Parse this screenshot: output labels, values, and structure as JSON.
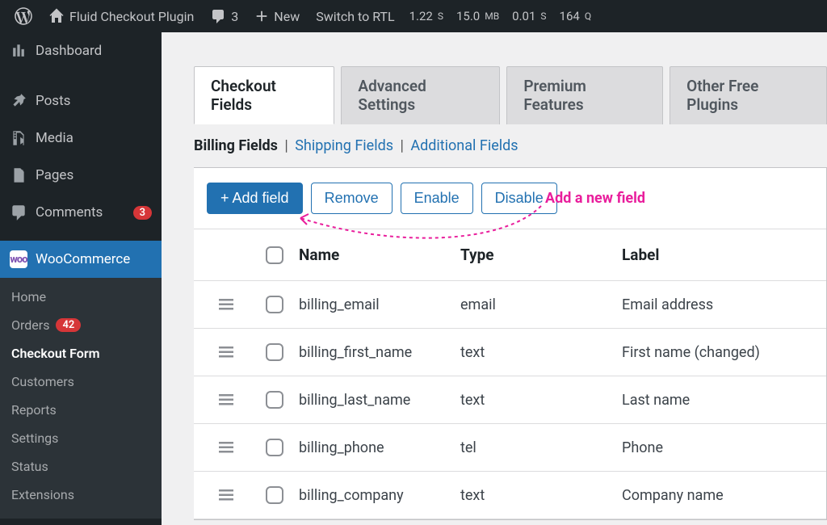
{
  "adminbar": {
    "site_title": "Fluid Checkout Plugin",
    "comments_count": "3",
    "new_label": "New",
    "rtl_label": "Switch to RTL",
    "stat_time": "1.22",
    "stat_time_unit": "S",
    "stat_mem": "15.0",
    "stat_mem_unit": "MB",
    "stat_sql": "0.01",
    "stat_sql_unit": "S",
    "stat_queries": "164",
    "stat_queries_unit": "Q"
  },
  "sidebar": {
    "dashboard": "Dashboard",
    "posts": "Posts",
    "media": "Media",
    "pages": "Pages",
    "comments": "Comments",
    "comments_badge": "3",
    "woocommerce": "WooCommerce",
    "submenu": {
      "home": "Home",
      "orders": "Orders",
      "orders_badge": "42",
      "checkout_form": "Checkout Form",
      "customers": "Customers",
      "reports": "Reports",
      "settings": "Settings",
      "status": "Status",
      "extensions": "Extensions"
    }
  },
  "tabs": {
    "checkout_fields": "Checkout Fields",
    "advanced_settings": "Advanced Settings",
    "premium_features": "Premium Features",
    "other_plugins": "Other Free Plugins"
  },
  "sublinks": {
    "billing": "Billing Fields",
    "shipping": "Shipping Fields",
    "additional": "Additional Fields"
  },
  "toolbar": {
    "add": "+ Add field",
    "remove": "Remove",
    "enable": "Enable",
    "disable": "Disable"
  },
  "table": {
    "head_name": "Name",
    "head_type": "Type",
    "head_label": "Label",
    "rows": [
      {
        "name": "billing_email",
        "type": "email",
        "label": "Email address"
      },
      {
        "name": "billing_first_name",
        "type": "text",
        "label": "First name (changed)"
      },
      {
        "name": "billing_last_name",
        "type": "text",
        "label": "Last name"
      },
      {
        "name": "billing_phone",
        "type": "tel",
        "label": "Phone"
      },
      {
        "name": "billing_company",
        "type": "text",
        "label": "Company name"
      }
    ]
  },
  "annotation": {
    "text": "Add a new field"
  }
}
